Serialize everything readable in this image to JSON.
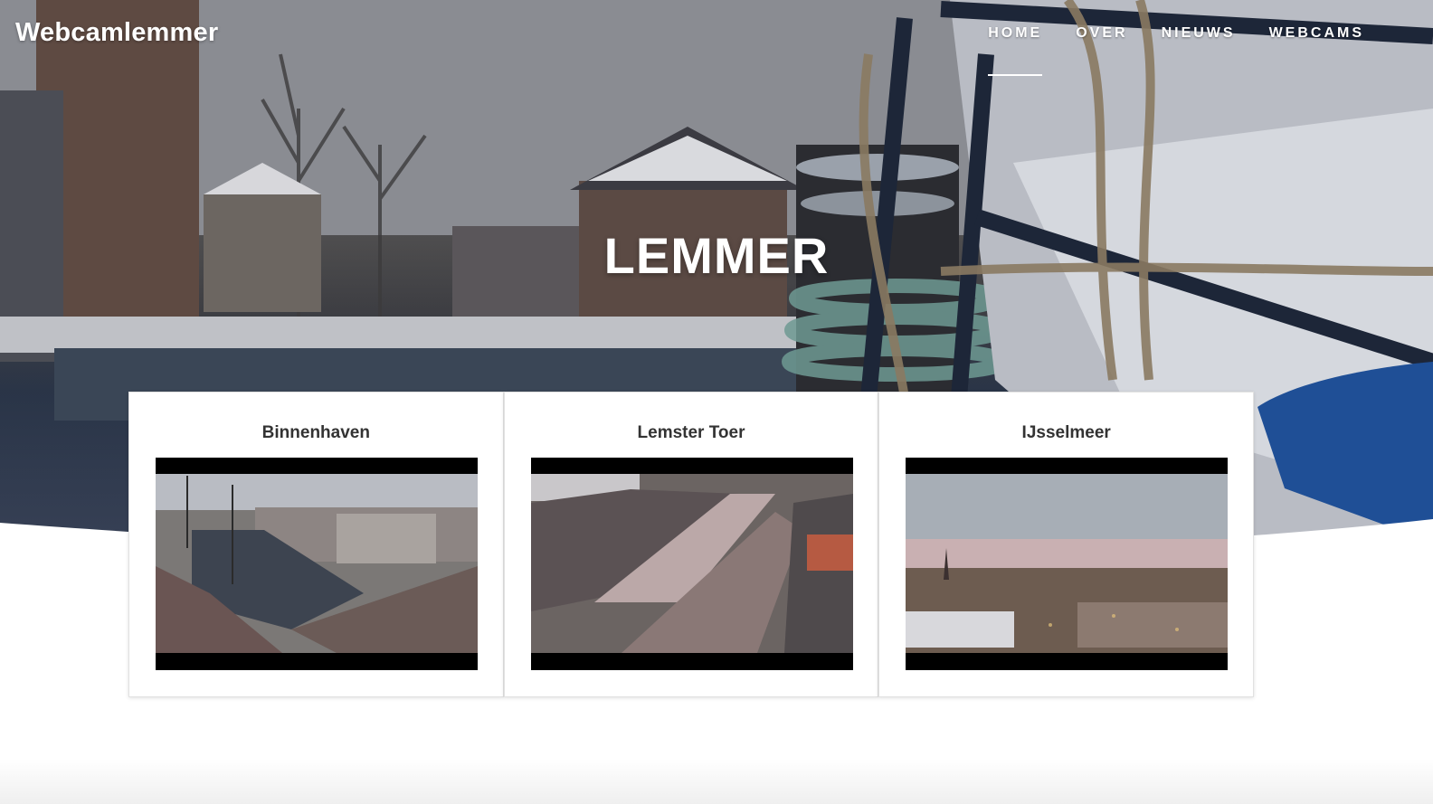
{
  "header": {
    "brand": "Webcamlemmer",
    "nav": [
      {
        "label": "HOME",
        "active": true
      },
      {
        "label": "OVER",
        "active": false
      },
      {
        "label": "NIEUWS",
        "active": false
      },
      {
        "label": "WEBCAMS",
        "active": false
      }
    ]
  },
  "hero": {
    "title": "LEMMER"
  },
  "webcams": [
    {
      "title": "Binnenhaven"
    },
    {
      "title": "Lemster Toer"
    },
    {
      "title": "IJsselmeer"
    }
  ],
  "colors": {
    "nav_text": "#ffffff",
    "card_title": "#333333",
    "card_border": "#e1e1e1"
  }
}
